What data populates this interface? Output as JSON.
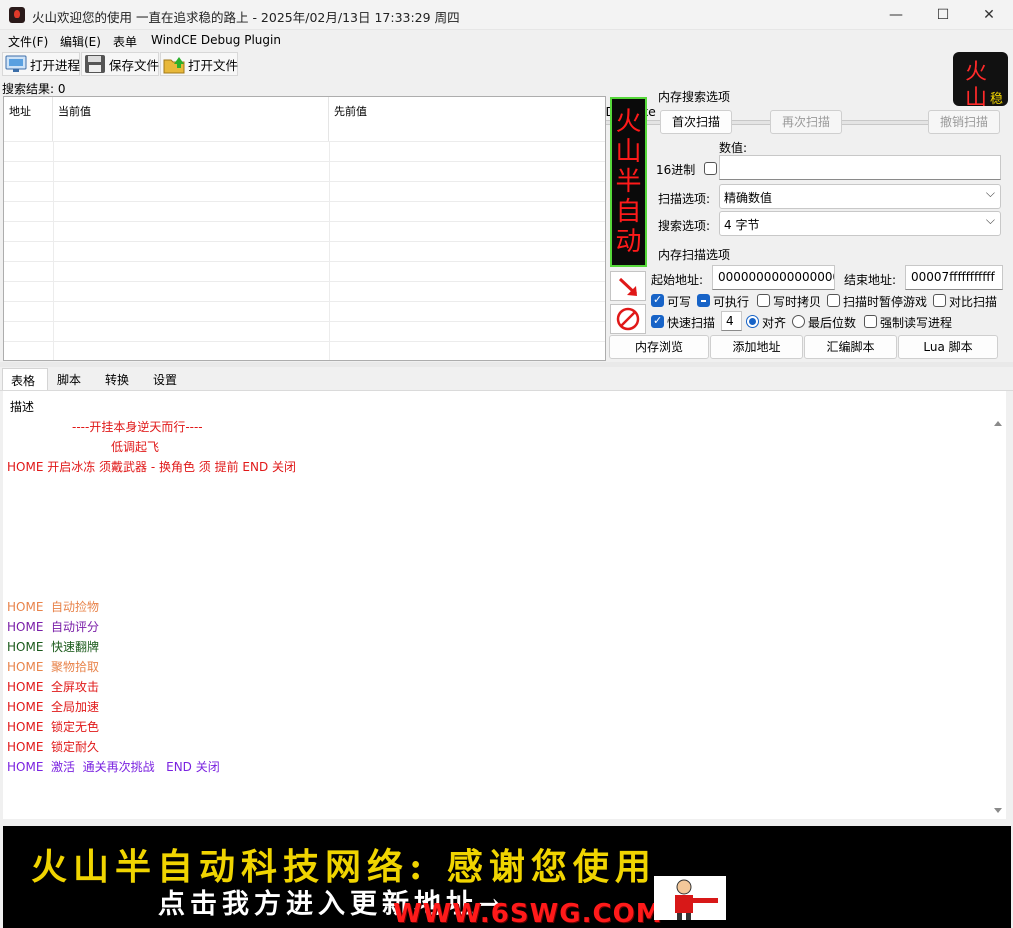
{
  "window": {
    "title": "火山欢迎您的使用 一直在追求稳的路上 - 2025年/02月/13日 17:33:29 周四",
    "minimize": "—",
    "maximize": "☐",
    "close": "✕"
  },
  "menu": [
    "文件(F)",
    "编辑(E)",
    "表单",
    "WindCE Debug Plugin"
  ],
  "toolbar": {
    "open_process": "打开进程",
    "save_file": "保存文件",
    "open_file": "打开文件",
    "process_name": "00004DB0-DNF.exe"
  },
  "logo": {
    "char1": "火",
    "char2": "山",
    "char3": "稳"
  },
  "results": {
    "label": "搜索结果: 0",
    "columns": [
      "地址",
      "当前值",
      "先前值"
    ]
  },
  "side_banner": [
    "火",
    "山",
    "半",
    "自",
    "动"
  ],
  "scan": {
    "group_title": "内存搜索选项",
    "first_scan": "首次扫描",
    "next_scan": "再次扫描",
    "undo_scan": "撤销扫描",
    "value_label": "数值:",
    "hex_label": "16进制",
    "value": "",
    "scan_type_label": "扫描选项:",
    "scan_type": "精确数值",
    "value_type_label": "搜索选项:",
    "value_type": "4 字节"
  },
  "memory_scan": {
    "group_title": "内存扫描选项",
    "start_label": "起始地址:",
    "start_value": "0000000000000000",
    "end_label": "结束地址:",
    "end_value": "00007fffffffffff",
    "writable": "可写",
    "executable": "可执行",
    "copy_on_write": "写时拷贝",
    "pause_game": "扫描时暂停游戏",
    "compare_scan": "对比扫描",
    "fast_scan": "快速扫描",
    "fast_scan_value": "4",
    "align": "对齐",
    "last_digits": "最后位数",
    "force_rw": "强制读写进程"
  },
  "actions": {
    "memory_view": "内存浏览",
    "add_address": "添加地址",
    "assemble_script": "汇编脚本",
    "lua_script": "Lua 脚本"
  },
  "tabs": [
    "表格",
    "脚本",
    "转换",
    "设置"
  ],
  "description": {
    "header": "描述",
    "line1": "----开挂本身逆天而行----",
    "line2": "低调起飞",
    "line3": "HOME 开启冰冻 须戴武器 - 换角色 须 提前 END 关闭",
    "items": [
      {
        "text": "HOME  自动捡物",
        "color": "#e8834a"
      },
      {
        "text": "HOME  自动评分",
        "color": "#7a1ea8"
      },
      {
        "text": "HOME  快速翻牌",
        "color": "#1a5a1a"
      },
      {
        "text": "HOME  聚物拾取",
        "color": "#e8834a"
      },
      {
        "text": "HOME  全屏攻击",
        "color": "#e01818"
      },
      {
        "text": "HOME  全局加速",
        "color": "#e01818"
      },
      {
        "text": "HOME  锁定无色",
        "color": "#e01818"
      },
      {
        "text": "HOME  锁定耐久",
        "color": "#e01818"
      },
      {
        "text": "HOME  激活  通关再次挑战   END 关闭",
        "color": "#7a22e0"
      }
    ]
  },
  "banner": {
    "title": "火山半自动科技网络: 感谢您使用",
    "subtitle": "点击我方进入更新地址→",
    "url": "WWW.6SWG.COM"
  },
  "colors": {
    "red_text": "#e01818",
    "accent": "#1763c7",
    "banner_yellow": "#f0d400"
  }
}
